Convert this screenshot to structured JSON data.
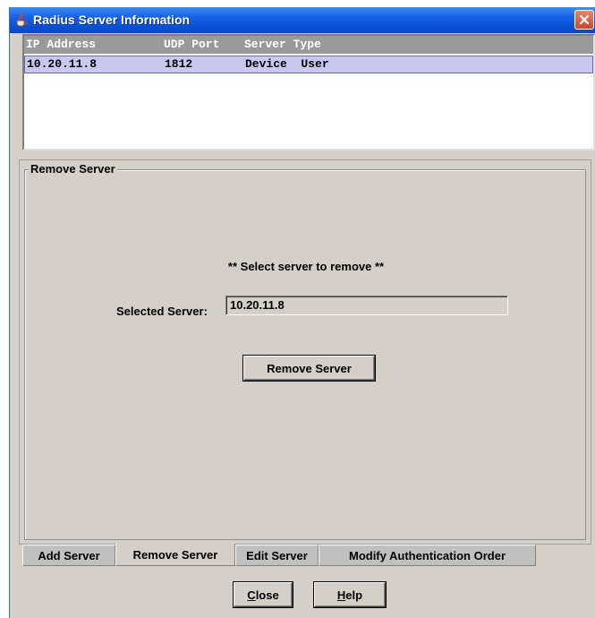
{
  "window": {
    "title": "Radius Server Information"
  },
  "table": {
    "columns": [
      "IP Address",
      "UDP Port",
      "Server Type"
    ],
    "rows": [
      {
        "ip": "10.20.11.8",
        "port": "1812",
        "type": "Device  User"
      }
    ]
  },
  "panel": {
    "group_title": "Remove Server",
    "instruction": "** Select server to remove **",
    "selected_label": "Selected Server:",
    "selected_value": "10.20.11.8",
    "remove_button": "Remove Server"
  },
  "tabs": [
    {
      "label": "Add Server",
      "active": false
    },
    {
      "label": "Remove Server",
      "active": true
    },
    {
      "label": "Edit Server",
      "active": false
    },
    {
      "label": "Modify Authentication Order",
      "active": false
    }
  ],
  "footer": {
    "close_label": "Close",
    "close_mnemonic": "C",
    "close_rest": "lose",
    "help_label": "Help",
    "help_mnemonic": "H",
    "help_rest": "elp"
  },
  "icons": {
    "app": "java-cup-icon",
    "close": "close-icon"
  },
  "colors": {
    "titlebar": "#0b4fd6",
    "selection": "#c8c8f0",
    "window_bg": "#d4d0c8",
    "header_bg": "#9a9a9a"
  }
}
